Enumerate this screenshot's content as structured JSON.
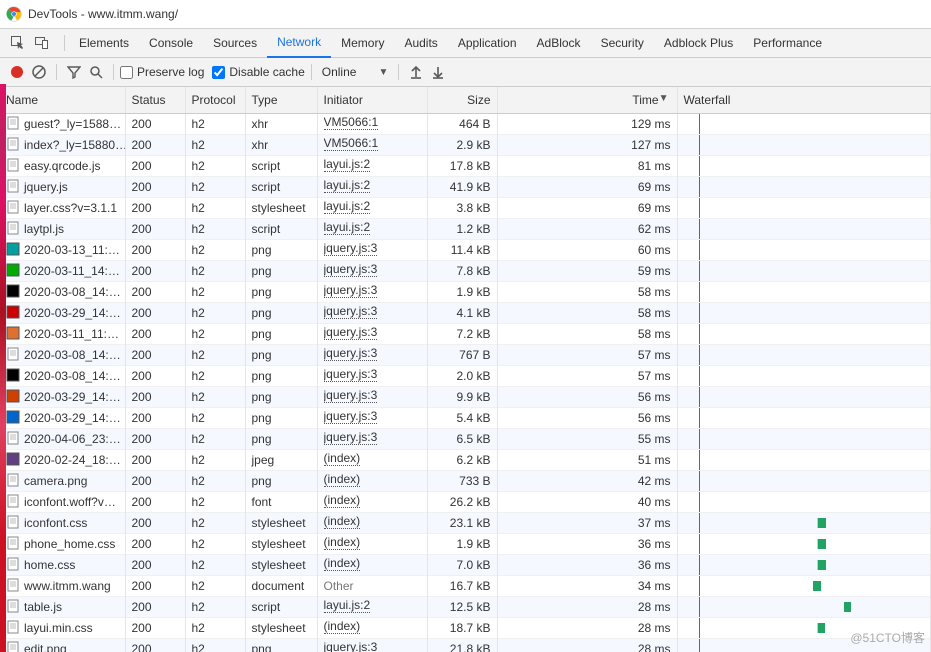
{
  "title": "DevTools - www.itmm.wang/",
  "panels": [
    "Elements",
    "Console",
    "Sources",
    "Network",
    "Memory",
    "Audits",
    "Application",
    "AdBlock",
    "Security",
    "Adblock Plus",
    "Performance"
  ],
  "active_panel": "Network",
  "preserve_label": "Preserve log",
  "disable_label": "Disable cache",
  "throttle": "Online",
  "columns": [
    "Name",
    "Status",
    "Protocol",
    "Type",
    "Initiator",
    "Size",
    "Time",
    "Waterfall"
  ],
  "watermark": "@51CTO博客",
  "rows": [
    {
      "icon": "doc",
      "name": "guest?_ly=1588…",
      "status": "200",
      "protocol": "h2",
      "type": "xhr",
      "initiator": "VM5066:1",
      "init_style": "link",
      "size": "464 B",
      "time": "129 ms"
    },
    {
      "icon": "doc",
      "name": "index?_ly=15880…",
      "status": "200",
      "protocol": "h2",
      "type": "xhr",
      "initiator": "VM5066:1",
      "init_style": "link",
      "size": "2.9 kB",
      "time": "127 ms"
    },
    {
      "icon": "doc",
      "name": "easy.qrcode.js",
      "status": "200",
      "protocol": "h2",
      "type": "script",
      "initiator": "layui.js:2",
      "init_style": "link",
      "size": "17.8 kB",
      "time": "81 ms"
    },
    {
      "icon": "doc",
      "name": "jquery.js",
      "status": "200",
      "protocol": "h2",
      "type": "script",
      "initiator": "layui.js:2",
      "init_style": "link",
      "size": "41.9 kB",
      "time": "69 ms"
    },
    {
      "icon": "doc",
      "name": "layer.css?v=3.1.1",
      "status": "200",
      "protocol": "h2",
      "type": "stylesheet",
      "initiator": "layui.js:2",
      "init_style": "link",
      "size": "3.8 kB",
      "time": "69 ms"
    },
    {
      "icon": "doc",
      "name": "laytpl.js",
      "status": "200",
      "protocol": "h2",
      "type": "script",
      "initiator": "layui.js:2",
      "init_style": "link",
      "size": "1.2 kB",
      "time": "62 ms"
    },
    {
      "icon": "img-teal",
      "name": "2020-03-13_11:…",
      "status": "200",
      "protocol": "h2",
      "type": "png",
      "initiator": "jquery.js:3",
      "init_style": "link",
      "size": "11.4 kB",
      "time": "60 ms"
    },
    {
      "icon": "img-green",
      "name": "2020-03-11_14:…",
      "status": "200",
      "protocol": "h2",
      "type": "png",
      "initiator": "jquery.js:3",
      "init_style": "link",
      "size": "7.8 kB",
      "time": "59 ms"
    },
    {
      "icon": "img-black",
      "name": "2020-03-08_14:…",
      "status": "200",
      "protocol": "h2",
      "type": "png",
      "initiator": "jquery.js:3",
      "init_style": "link",
      "size": "1.9 kB",
      "time": "58 ms"
    },
    {
      "icon": "img-red",
      "name": "2020-03-29_14:…",
      "status": "200",
      "protocol": "h2",
      "type": "png",
      "initiator": "jquery.js:3",
      "init_style": "link",
      "size": "4.1 kB",
      "time": "58 ms"
    },
    {
      "icon": "img-orange",
      "name": "2020-03-11_11:…",
      "status": "200",
      "protocol": "h2",
      "type": "png",
      "initiator": "jquery.js:3",
      "init_style": "link",
      "size": "7.2 kB",
      "time": "58 ms"
    },
    {
      "icon": "doc",
      "name": "2020-03-08_14:…",
      "status": "200",
      "protocol": "h2",
      "type": "png",
      "initiator": "jquery.js:3",
      "init_style": "link",
      "size": "767 B",
      "time": "57 ms"
    },
    {
      "icon": "img-black",
      "name": "2020-03-08_14:…",
      "status": "200",
      "protocol": "h2",
      "type": "png",
      "initiator": "jquery.js:3",
      "init_style": "link",
      "size": "2.0 kB",
      "time": "57 ms"
    },
    {
      "icon": "img-fire",
      "name": "2020-03-29_14:…",
      "status": "200",
      "protocol": "h2",
      "type": "png",
      "initiator": "jquery.js:3",
      "init_style": "link",
      "size": "9.9 kB",
      "time": "56 ms"
    },
    {
      "icon": "img-blue",
      "name": "2020-03-29_14:…",
      "status": "200",
      "protocol": "h2",
      "type": "png",
      "initiator": "jquery.js:3",
      "init_style": "link",
      "size": "5.4 kB",
      "time": "56 ms"
    },
    {
      "icon": "doc",
      "name": "2020-04-06_23:…",
      "status": "200",
      "protocol": "h2",
      "type": "png",
      "initiator": "jquery.js:3",
      "init_style": "link",
      "size": "6.5 kB",
      "time": "55 ms"
    },
    {
      "icon": "img-purple",
      "name": "2020-02-24_18:…",
      "status": "200",
      "protocol": "h2",
      "type": "jpeg",
      "initiator": "(index)",
      "init_style": "link",
      "size": "6.2 kB",
      "time": "51 ms"
    },
    {
      "icon": "doc",
      "name": "camera.png",
      "status": "200",
      "protocol": "h2",
      "type": "png",
      "initiator": "(index)",
      "init_style": "link",
      "size": "733 B",
      "time": "42 ms"
    },
    {
      "icon": "doc",
      "name": "iconfont.woff?v…",
      "status": "200",
      "protocol": "h2",
      "type": "font",
      "initiator": "(index)",
      "init_style": "link",
      "size": "26.2 kB",
      "time": "40 ms"
    },
    {
      "icon": "doc",
      "name": "iconfont.css",
      "status": "200",
      "protocol": "h2",
      "type": "stylesheet",
      "initiator": "(index)",
      "init_style": "link",
      "size": "23.1 kB",
      "time": "37 ms",
      "wf_q": 740,
      "wf_w": 6,
      "wf_s": 748,
      "wf_e": 8
    },
    {
      "icon": "doc",
      "name": "phone_home.css",
      "status": "200",
      "protocol": "h2",
      "type": "stylesheet",
      "initiator": "(index)",
      "init_style": "link",
      "size": "1.9 kB",
      "time": "36 ms",
      "wf_q": 740,
      "wf_w": 6,
      "wf_s": 748,
      "wf_e": 8
    },
    {
      "icon": "doc",
      "name": "home.css",
      "status": "200",
      "protocol": "h2",
      "type": "stylesheet",
      "initiator": "(index)",
      "init_style": "link",
      "size": "7.0 kB",
      "time": "36 ms",
      "wf_q": 740,
      "wf_w": 6,
      "wf_s": 748,
      "wf_e": 8
    },
    {
      "icon": "doc",
      "name": "www.itmm.wang",
      "status": "200",
      "protocol": "h2",
      "type": "document",
      "initiator": "Other",
      "init_style": "other",
      "size": "16.7 kB",
      "time": "34 ms",
      "wf_s": 720,
      "wf_e": 8
    },
    {
      "icon": "doc",
      "name": "table.js",
      "status": "200",
      "protocol": "h2",
      "type": "script",
      "initiator": "layui.js:2",
      "init_style": "link",
      "size": "12.5 kB",
      "time": "28 ms",
      "wf_s": 892,
      "wf_e": 8
    },
    {
      "icon": "doc",
      "name": "layui.min.css",
      "status": "200",
      "protocol": "h2",
      "type": "stylesheet",
      "initiator": "(index)",
      "init_style": "link",
      "size": "18.7 kB",
      "time": "28 ms",
      "wf_q": 740,
      "wf_w": 6,
      "wf_s": 748,
      "wf_e": 7
    },
    {
      "icon": "doc",
      "name": "edit.png",
      "status": "200",
      "protocol": "h2",
      "type": "png",
      "initiator": "jquery.js:3",
      "init_style": "link",
      "size": "21.8 kB",
      "time": "28 ms"
    }
  ]
}
